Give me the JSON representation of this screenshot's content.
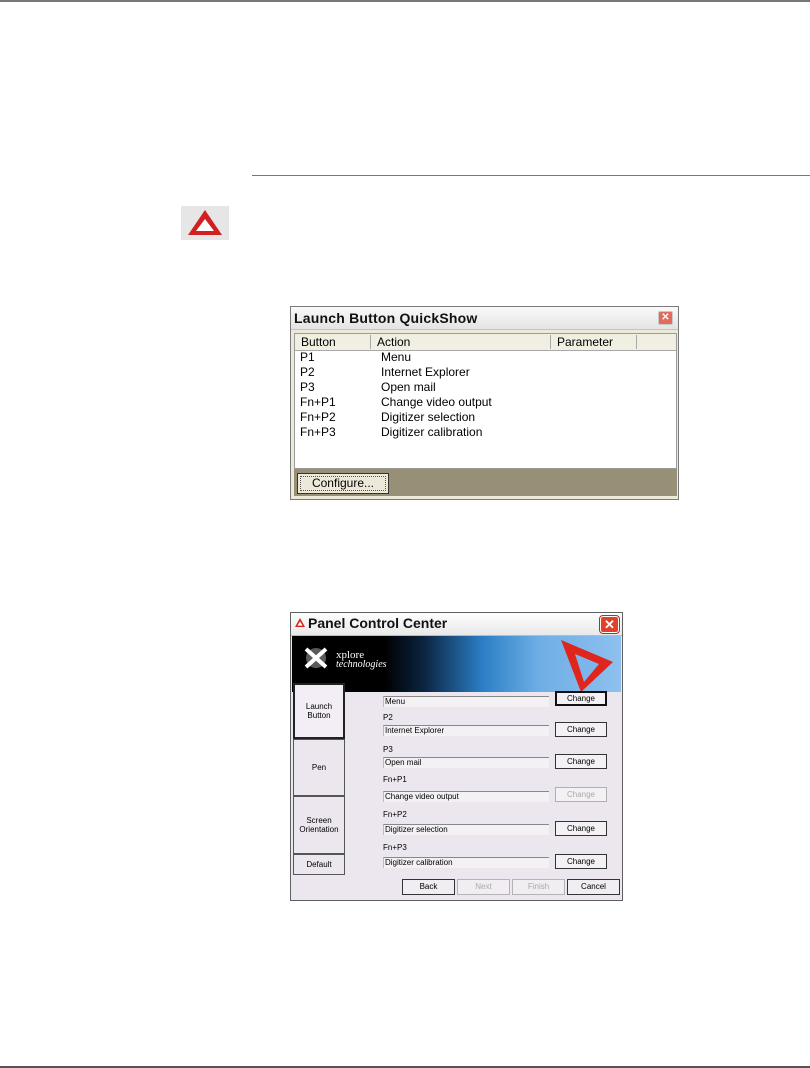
{
  "quickshow": {
    "title": "Launch Button QuickShow",
    "columns": [
      "Button",
      "Action",
      "Parameter"
    ],
    "rows": [
      {
        "button": "P1",
        "action": "Menu"
      },
      {
        "button": "P2",
        "action": "Internet Explorer"
      },
      {
        "button": "P3",
        "action": "Open mail"
      },
      {
        "button": "Fn+P1",
        "action": "Change video output"
      },
      {
        "button": "Fn+P2",
        "action": "Digitizer selection"
      },
      {
        "button": "Fn+P3",
        "action": "Digitizer calibration"
      }
    ],
    "configure_label": "Configure..."
  },
  "pcc": {
    "title": "Panel Control Center",
    "logo_line1": "xplore",
    "logo_line2": "technologies",
    "tabs": {
      "launch_line1": "Launch",
      "launch_line2": "Button",
      "pen": "Pen",
      "screen_line1": "Screen",
      "screen_line2": "Orientation",
      "default": "Default"
    },
    "fields": [
      {
        "label": "P1",
        "value": "Menu",
        "button": "Change",
        "enabled": true
      },
      {
        "label": "P2",
        "value": "Internet Explorer",
        "button": "Change",
        "enabled": true
      },
      {
        "label": "P3",
        "value": "Open mail",
        "button": "Change",
        "enabled": true
      },
      {
        "label": "Fn+P1",
        "value": "Change video output",
        "button": "Change",
        "enabled": false
      },
      {
        "label": "Fn+P2",
        "value": "Digitizer selection",
        "button": "Change",
        "enabled": true
      },
      {
        "label": "Fn+P3",
        "value": "Digitizer calibration",
        "button": "Change",
        "enabled": true
      }
    ],
    "nav": {
      "back": "Back",
      "next": "Next",
      "finish": "Finish",
      "cancel": "Cancel"
    }
  },
  "colors": {
    "accent_red": "#e03a2a",
    "banner_blue": "#5fa6e6"
  }
}
